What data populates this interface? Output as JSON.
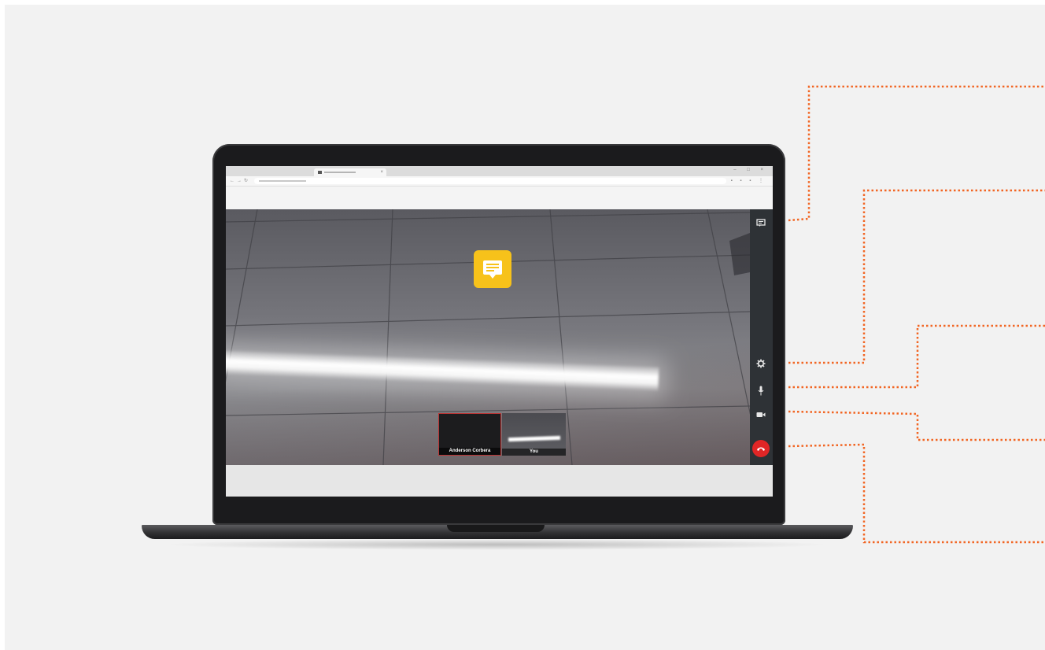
{
  "colors": {
    "background": "#f2f2f2",
    "accent_callout": "#f26522",
    "chat_bubble": "#f7c21a",
    "hangup": "#e02626",
    "rail": "#2e3236"
  },
  "browser": {
    "tab_close_glyph": "×",
    "window_controls": "– □ ×",
    "nav_back": "←",
    "nav_forward": "→",
    "nav_reload": "↻"
  },
  "video_call": {
    "chat_icon": "chat-bubble-icon",
    "participants": [
      {
        "label": "Anderson Corbera",
        "video_on": false
      },
      {
        "label": "You",
        "video_on": true
      }
    ],
    "controls": [
      {
        "name": "chat",
        "icon": "chat-icon"
      },
      {
        "name": "settings",
        "icon": "gear-icon"
      },
      {
        "name": "microphone",
        "icon": "microphone-icon"
      },
      {
        "name": "camera",
        "icon": "video-camera-icon"
      },
      {
        "name": "hang-up",
        "icon": "phone-hangup-icon"
      }
    ]
  }
}
